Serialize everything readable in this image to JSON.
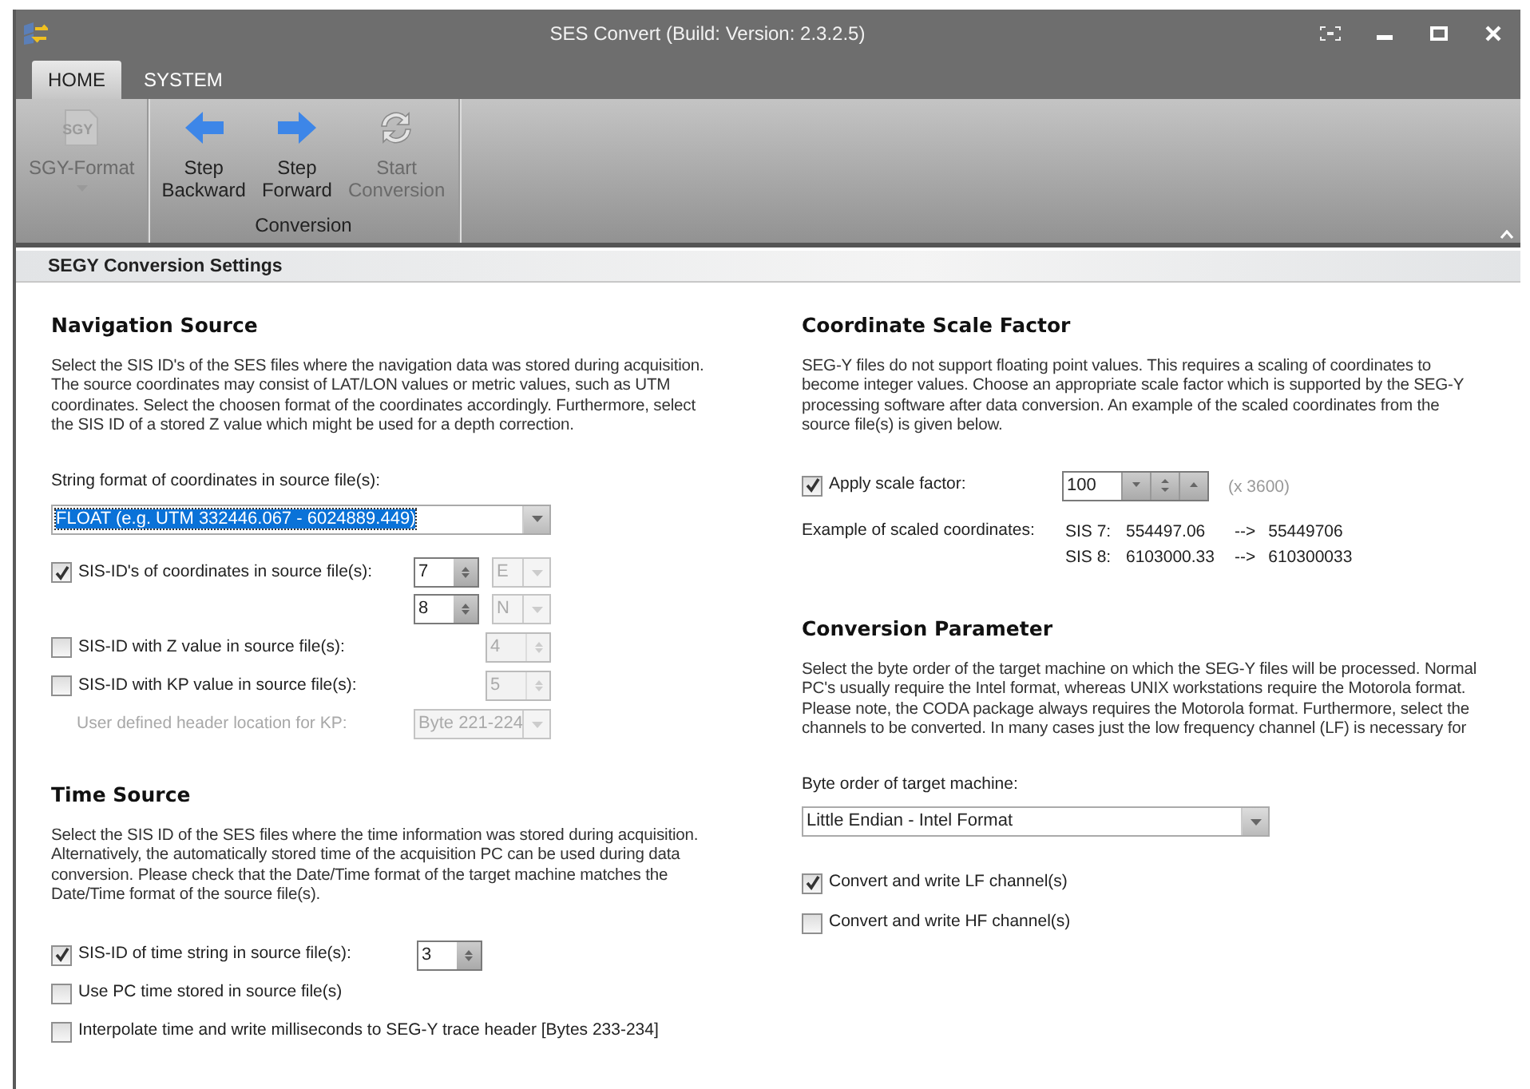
{
  "window": {
    "title": "SES Convert (Build: Version: 2.3.2.5)"
  },
  "tabs": [
    {
      "label": "HOME",
      "selected": true
    },
    {
      "label": "SYSTEM",
      "selected": false
    }
  ],
  "ribbon": {
    "groups": [
      {
        "buttons": [
          {
            "kind": "sgy",
            "icon_text": "SGY",
            "lines": [
              "SGY-Format"
            ],
            "disabled": true,
            "dropdown": true
          }
        ]
      },
      {
        "label": "Conversion",
        "buttons": [
          {
            "kind": "back",
            "lines": [
              "Step",
              "Backward"
            ],
            "disabled": false,
            "dropdown": false
          },
          {
            "kind": "forward",
            "lines": [
              "Step",
              "Forward"
            ],
            "disabled": false,
            "dropdown": false
          },
          {
            "kind": "start",
            "lines": [
              "Start",
              "Conversion"
            ],
            "disabled": true,
            "dropdown": false
          }
        ]
      }
    ]
  },
  "panel_title": "SEGY Conversion Settings",
  "navigation": {
    "title": "Navigation Source",
    "description": [
      "Select the SIS ID's of the SES files where the navigation data was stored during acquisition.",
      "The source coordinates may consist of LAT/LON values or metric values, such as UTM",
      "coordinates. Select the choosen format of the coordinates accordingly. Furthermore, select",
      "the SIS ID of a stored Z value which might be used for a depth correction."
    ],
    "format_label": "String format of coordinates in source file(s):",
    "format_value": "FLOAT  (e.g. UTM 332446.067 - 6024889.449)",
    "format_selected": true,
    "rows": [
      {
        "kind": "check",
        "label": "SIS-ID's of coordinates in source file(s):",
        "checked": true,
        "spins": [
          {
            "value": "7",
            "disabled": false,
            "axis": {
              "value": "E",
              "disabled": true
            }
          },
          {
            "value": "8",
            "disabled": false,
            "axis": {
              "value": "N",
              "disabled": true
            }
          }
        ]
      },
      {
        "kind": "check",
        "label": "SIS-ID with Z value in source file(s):",
        "checked": false,
        "spins": [
          {
            "value": "4",
            "disabled": true
          }
        ]
      },
      {
        "kind": "check",
        "label": "SIS-ID with KP value in source file(s):",
        "checked": false,
        "spins": [
          {
            "value": "5",
            "disabled": true
          }
        ]
      },
      {
        "kind": "combo",
        "label": "User defined header location for KP:",
        "disabled": true,
        "value": "Byte 221-224"
      }
    ]
  },
  "time": {
    "title": "Time Source",
    "description": [
      "Select the SIS ID of the SES files where the time information was stored during acquisition.",
      "Alternatively, the automatically stored time of the acquisition PC can be used during data",
      "conversion. Please check that the Date/Time format of the target machine matches the",
      "Date/Time format of the source file(s)."
    ],
    "rows": [
      {
        "kind": "check",
        "label": "SIS-ID of time string in source file(s):",
        "checked": true,
        "spins": [
          {
            "value": "3",
            "disabled": false
          }
        ]
      },
      {
        "kind": "check",
        "label": "Use PC time stored in source file(s)",
        "checked": false
      },
      {
        "kind": "check",
        "label": "Interpolate time and write milliseconds to SEG-Y trace header [Bytes 233-234]",
        "checked": false
      }
    ]
  },
  "scale": {
    "title": "Coordinate Scale Factor",
    "description": [
      "SEG-Y files do not support floating point values. This requires a scaling of coordinates to",
      "become integer values. Choose an appropriate scale factor which is supported by the SEG-Y",
      "processing software after data conversion. An example of the scaled coordinates from the",
      "source file(s) is given below."
    ],
    "apply": {
      "label": "Apply scale factor:",
      "checked": true,
      "value": "100",
      "note": "(x 3600)"
    },
    "example_label": "Example of scaled coordinates:",
    "examples": [
      {
        "sis": "SIS 7:",
        "from": "554497.06",
        "arrow": "-->",
        "to": "55449706"
      },
      {
        "sis": "SIS 8:",
        "from": "6103000.33",
        "arrow": "-->",
        "to": "610300033"
      }
    ]
  },
  "conversion": {
    "title": "Conversion Parameter",
    "description": [
      "Select the byte order of the target machine on which the SEG-Y files will be processed. Normal",
      "PC's usually require the Intel format, whereas UNIX workstations require the Motorola format.",
      "Please note, the CODA package always requires the Motorola format. Furthermore, select the",
      "channels to be converted. In many cases just the low frequency channel (LF) is necessary for"
    ],
    "byte_label": "Byte order of target machine:",
    "byte_value": "Little Endian - Intel Format",
    "checks": [
      {
        "label": "Convert and write LF channel(s)",
        "checked": true
      },
      {
        "label": "Convert and write HF channel(s)",
        "checked": false
      }
    ]
  }
}
